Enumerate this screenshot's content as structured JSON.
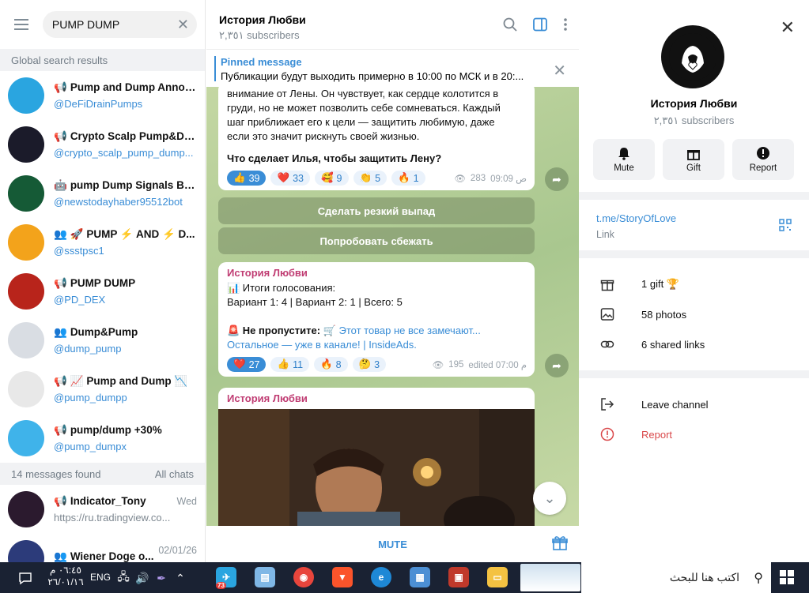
{
  "search": {
    "value": "PUMP DUMP"
  },
  "sections": {
    "global": "Global search results",
    "messages_found": "14 messages found",
    "all_chats": "All chats"
  },
  "results": [
    {
      "name": "Pump and Dump Annou...",
      "sub": "@DeFiDrainPumps",
      "type": "channel",
      "color": "#2aa5e0"
    },
    {
      "name": "Crypto Scalp Pump&Du...",
      "sub": "@crypto_scalp_pump_dump...",
      "type": "channel",
      "color": "#1b1b2a"
    },
    {
      "name": "pump Dump Signals Bin...",
      "sub": "@newstodayhaber95512bot",
      "type": "bot",
      "color": "#155a36"
    },
    {
      "name": "🚀 PUMP ⚡ AND ⚡ D...",
      "sub": "@ssstpsc1",
      "type": "group",
      "color": "#f3a31b"
    },
    {
      "name": "PUMP DUMP",
      "sub": "@PD_DEX",
      "type": "channel",
      "color": "#b8241b"
    },
    {
      "name": "Dump&Pump",
      "sub": "@dump_pump",
      "type": "group",
      "color": "#d9dde3"
    },
    {
      "name": "📈 Pump and Dump 📉",
      "sub": "@pump_dumpp",
      "type": "channel",
      "color": "#e8e8e8"
    },
    {
      "name": "pump/dump +30%",
      "sub": "@pump_dumpx",
      "type": "channel",
      "color": "#3fb3ea"
    }
  ],
  "messages": [
    {
      "name": "Indicator_Tony",
      "sub": "https://ru.tradingview.co...",
      "date": "Wed",
      "type": "channel",
      "color": "#2b1a2e"
    },
    {
      "name": "Wiener Doge o...",
      "sub": "",
      "date": "02/01/26",
      "type": "group",
      "color": "#2c3b7a"
    }
  ],
  "chat": {
    "title": "История Любви",
    "subscribers": "٢,٣٥١ subscribers",
    "pinned_title": "Pinned message",
    "pinned_text": "Публикации будут выходить примерно в 10:00 по МСК и в 20:...",
    "msg1_lines": [
      "внимание от Лены. Он чувствует, как сердце колотится в",
      "груди, но не может позволить себе сомневаться. Каждый",
      "шаг приближает его к цели — защитить любимую, даже",
      "если это значит рискнуть своей жизнью."
    ],
    "msg1_question": "Что сделает Илья, чтобы защитить Лену?",
    "msg1_reacts": [
      {
        "e": "👍",
        "n": "39",
        "sel": true
      },
      {
        "e": "❤️",
        "n": "33"
      },
      {
        "e": "🥰",
        "n": "9"
      },
      {
        "e": "👏",
        "n": "5"
      },
      {
        "e": "🔥",
        "n": "1"
      }
    ],
    "msg1_views": "283",
    "msg1_time": "09:09 ص",
    "btn1": "Сделать резкий выпад",
    "btn2": "Попробовать сбежать",
    "msg2_author": "История Любви",
    "msg2_line1": "📊 Итоги голосования:",
    "msg2_line2": "Вариант 1: 4 | Вариант 2: 1 | Всего: 5",
    "msg2_line3a": "🚨 Не пропустите: 🛒",
    "msg2_line3b": "Этот товар не все замечают...",
    "msg2_line4": "Остальное — уже в канале! | InsideAds.",
    "msg2_reacts": [
      {
        "e": "❤️",
        "n": "27",
        "sel": true
      },
      {
        "e": "👍",
        "n": "11"
      },
      {
        "e": "🔥",
        "n": "8"
      },
      {
        "e": "🤔",
        "n": "3"
      }
    ],
    "msg2_views": "195",
    "msg2_time": "edited 07:00 م",
    "msg3_author": "История Любви",
    "footer_mute": "MUTE"
  },
  "profile": {
    "name": "История Любви",
    "subscribers": "٢,٣٥١ subscribers",
    "actions": [
      "Mute",
      "Gift",
      "Report"
    ],
    "link": "t.me/StoryOfLove",
    "link_label": "Link",
    "gifts": "1 gift 🏆",
    "photos": "58 photos",
    "links": "6 shared links",
    "leave": "Leave channel",
    "report": "Report"
  },
  "taskbar": {
    "time": "٠٦:٤٥ م",
    "date": "٢٦/٠١/١٦",
    "lang": "ENG",
    "search_text": "اكتب هنا للبحث",
    "telegram_badge": "73"
  }
}
